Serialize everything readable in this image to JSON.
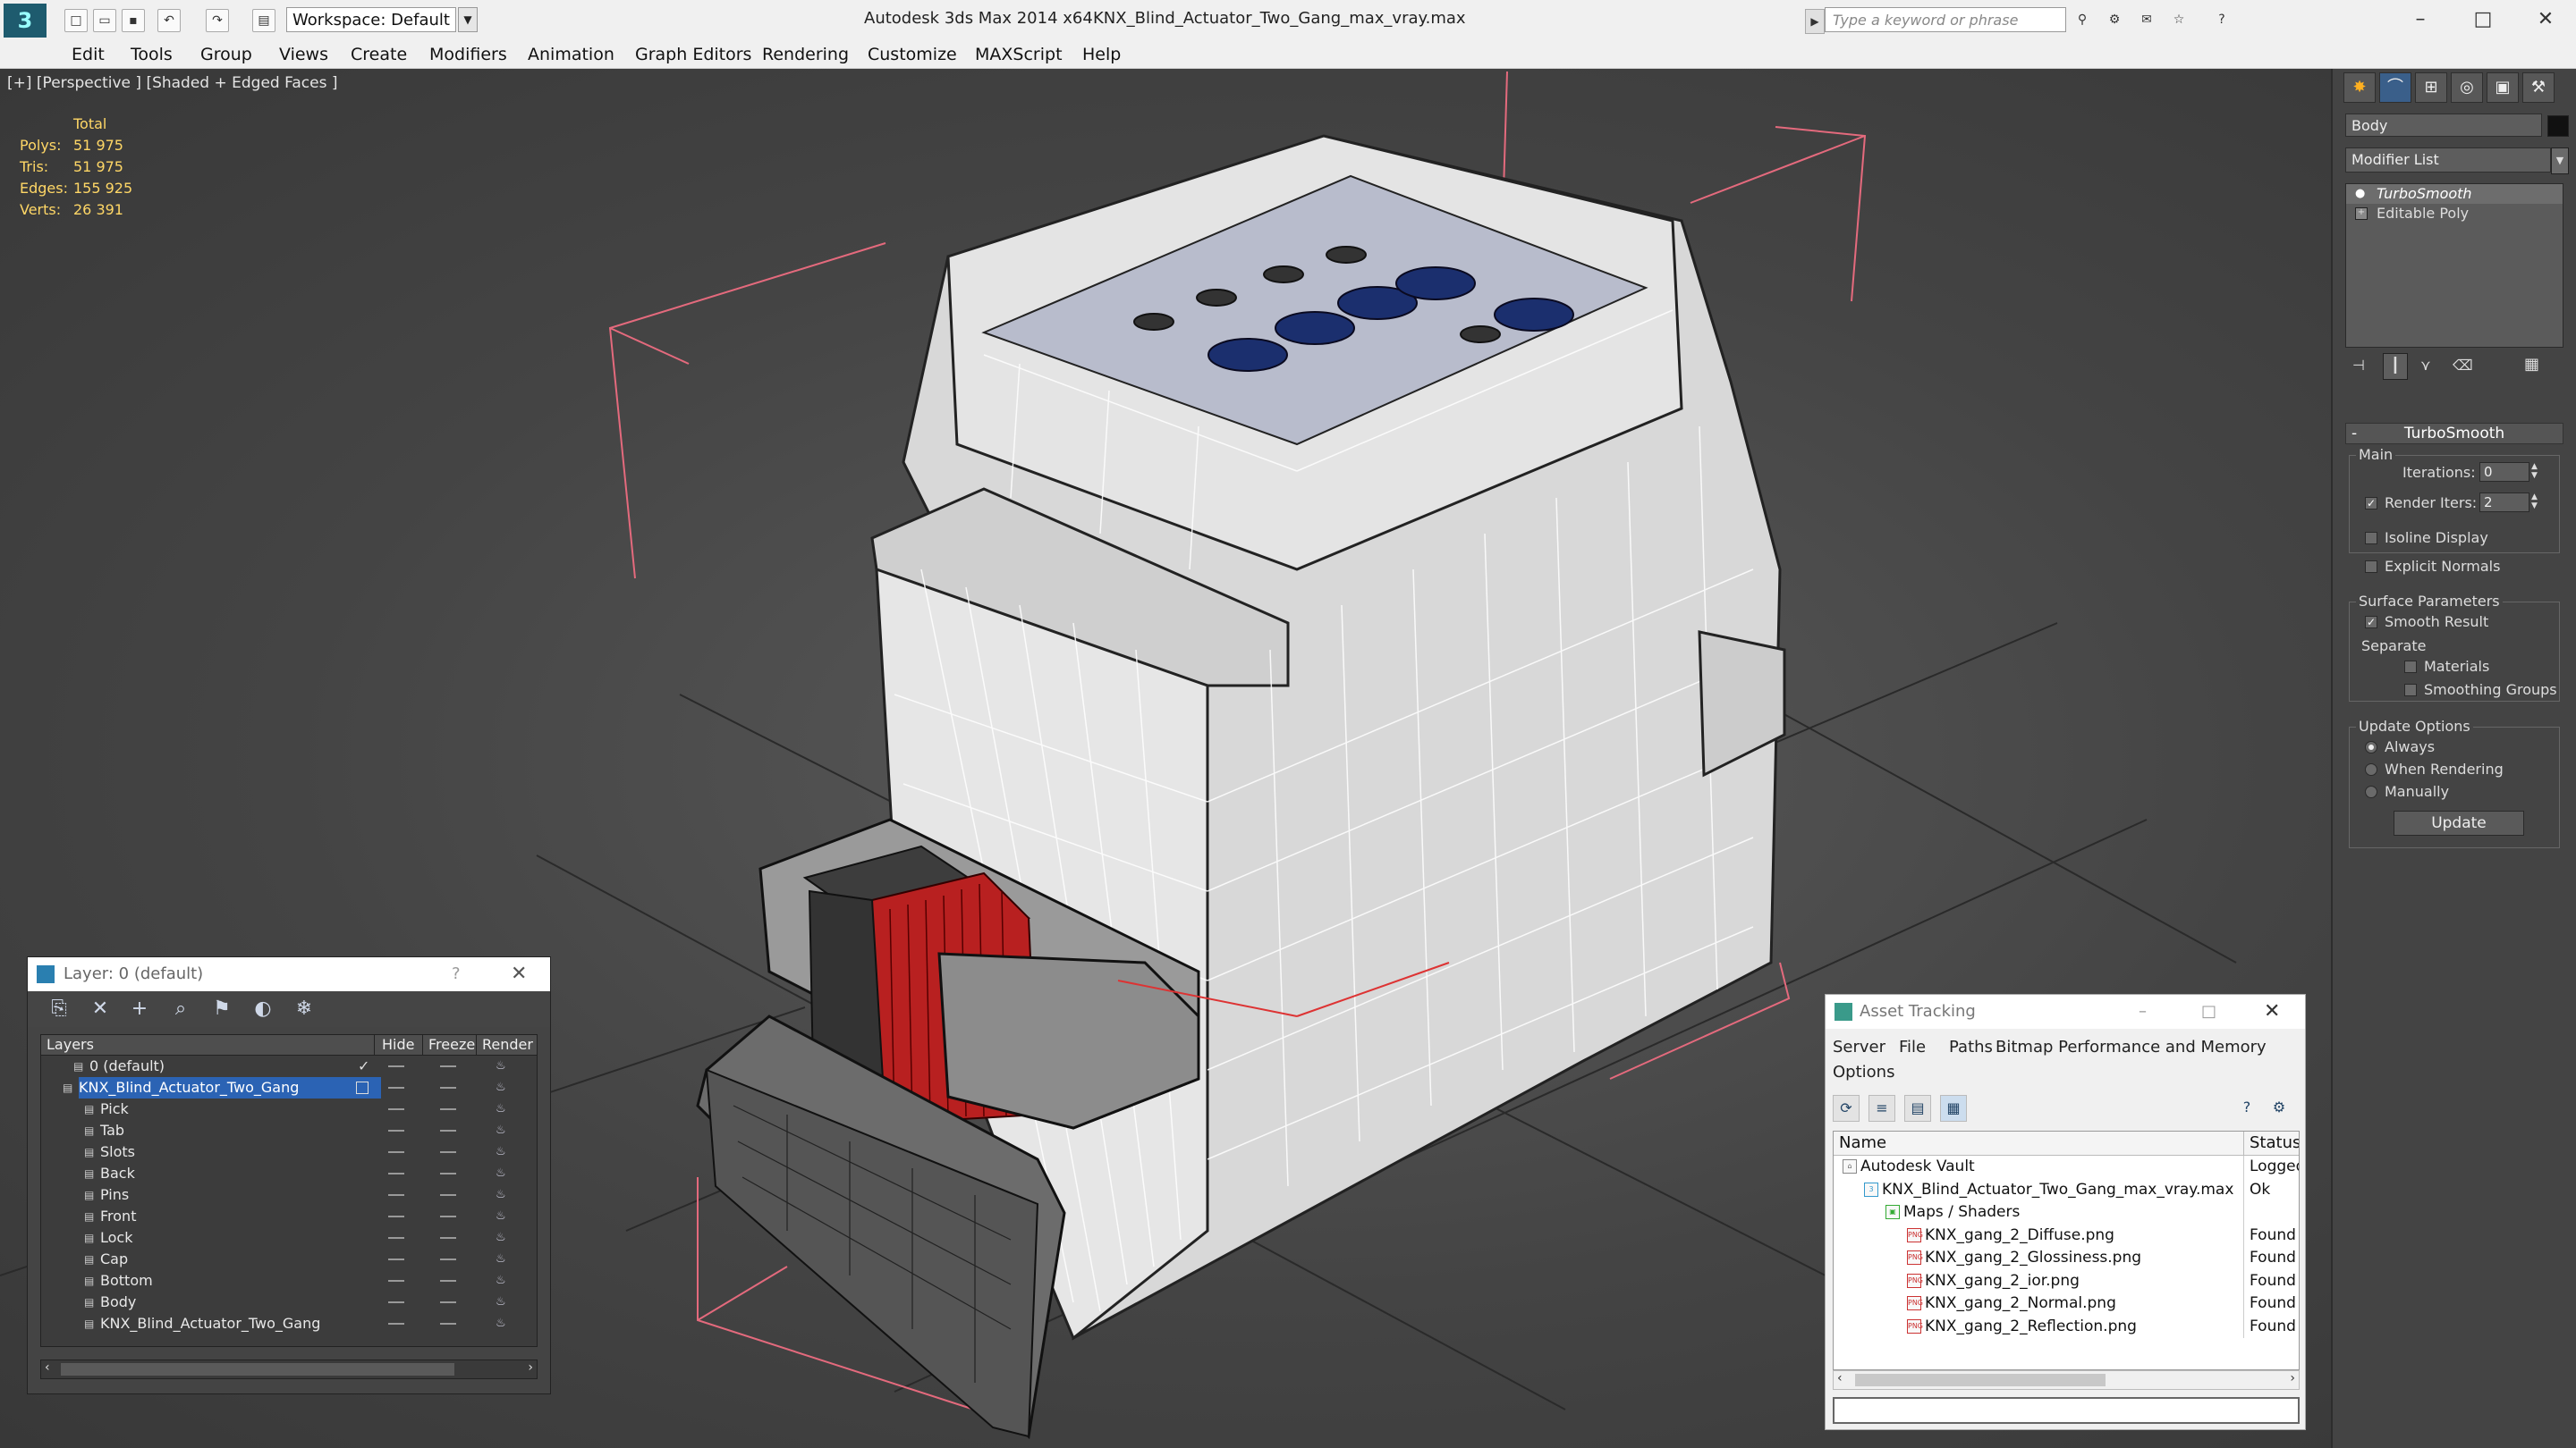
{
  "app": {
    "title": "Autodesk 3ds Max  2014 x64",
    "file": "KNX_Blind_Actuator_Two_Gang_max_vray.max",
    "workspace": "Workspace: Default",
    "search_placeholder": "Type a keyword or phrase"
  },
  "menu": [
    "Edit",
    "Tools",
    "Group",
    "Views",
    "Create",
    "Modifiers",
    "Animation",
    "Graph Editors",
    "Rendering",
    "Customize",
    "MAXScript",
    "Help"
  ],
  "viewport": {
    "label": "[+] [Perspective ] [Shaded + Edged Faces ]",
    "stats": {
      "header": "Total",
      "rows": [
        {
          "label": "Polys:",
          "value": "51 975"
        },
        {
          "label": "Tris:",
          "value": "51 975"
        },
        {
          "label": "Edges:",
          "value": "155 925"
        },
        {
          "label": "Verts:",
          "value": "26 391"
        }
      ]
    }
  },
  "command_panel": {
    "object_name": "Body",
    "modifier_list": "Modifier List",
    "stack": [
      "TurboSmooth",
      "Editable Poly"
    ],
    "rollout_title": "TurboSmooth",
    "main_group": "Main",
    "iterations_label": "Iterations:",
    "iterations_value": "0",
    "render_iters_label": "Render Iters:",
    "render_iters_value": "2",
    "isoline": "Isoline Display",
    "explicit_normals": "Explicit Normals",
    "surface_group": "Surface Parameters",
    "smooth_result": "Smooth Result",
    "separate": "Separate",
    "materials": "Materials",
    "smoothing_groups": "Smoothing Groups",
    "update_group": "Update Options",
    "always": "Always",
    "when_rendering": "When Rendering",
    "manually": "Manually",
    "update_button": "Update"
  },
  "layer_window": {
    "title": "Layer: 0 (default)",
    "columns": [
      "Layers",
      "Hide",
      "Freeze",
      "Render"
    ],
    "rows": [
      {
        "name": "0 (default)",
        "level": 1,
        "selected": false
      },
      {
        "name": "KNX_Blind_Actuator_Two_Gang",
        "level": 0,
        "selected": true
      },
      {
        "name": "Pick",
        "level": 2,
        "selected": false
      },
      {
        "name": "Tab",
        "level": 2,
        "selected": false
      },
      {
        "name": "Slots",
        "level": 2,
        "selected": false
      },
      {
        "name": "Back",
        "level": 2,
        "selected": false
      },
      {
        "name": "Pins",
        "level": 2,
        "selected": false
      },
      {
        "name": "Front",
        "level": 2,
        "selected": false
      },
      {
        "name": "Lock",
        "level": 2,
        "selected": false
      },
      {
        "name": "Cap",
        "level": 2,
        "selected": false
      },
      {
        "name": "Bottom",
        "level": 2,
        "selected": false
      },
      {
        "name": "Body",
        "level": 2,
        "selected": false
      },
      {
        "name": "KNX_Blind_Actuator_Two_Gang",
        "level": 2,
        "selected": false
      }
    ]
  },
  "asset_tracking": {
    "title": "Asset Tracking",
    "menu": [
      "Server",
      "File",
      "Paths",
      "Bitmap Performance and Memory",
      "Options"
    ],
    "columns": [
      "Name",
      "Status"
    ],
    "rows": [
      {
        "name": "Autodesk Vault",
        "status": "Logged",
        "indent": 0
      },
      {
        "name": "KNX_Blind_Actuator_Two_Gang_max_vray.max",
        "status": "Ok",
        "indent": 1
      },
      {
        "name": "Maps / Shaders",
        "status": "",
        "indent": 2
      },
      {
        "name": "KNX_gang_2_Diffuse.png",
        "status": "Found",
        "indent": 3
      },
      {
        "name": "KNX_gang_2_Glossiness.png",
        "status": "Found",
        "indent": 3
      },
      {
        "name": "KNX_gang_2_ior.png",
        "status": "Found",
        "indent": 3
      },
      {
        "name": "KNX_gang_2_Normal.png",
        "status": "Found",
        "indent": 3
      },
      {
        "name": "KNX_gang_2_Reflection.png",
        "status": "Found",
        "indent": 3
      }
    ]
  },
  "colors": {
    "stats_yellow": "#ffd766",
    "selection_blue": "#2b63b4",
    "bbox_pink": "#e46a7d"
  }
}
